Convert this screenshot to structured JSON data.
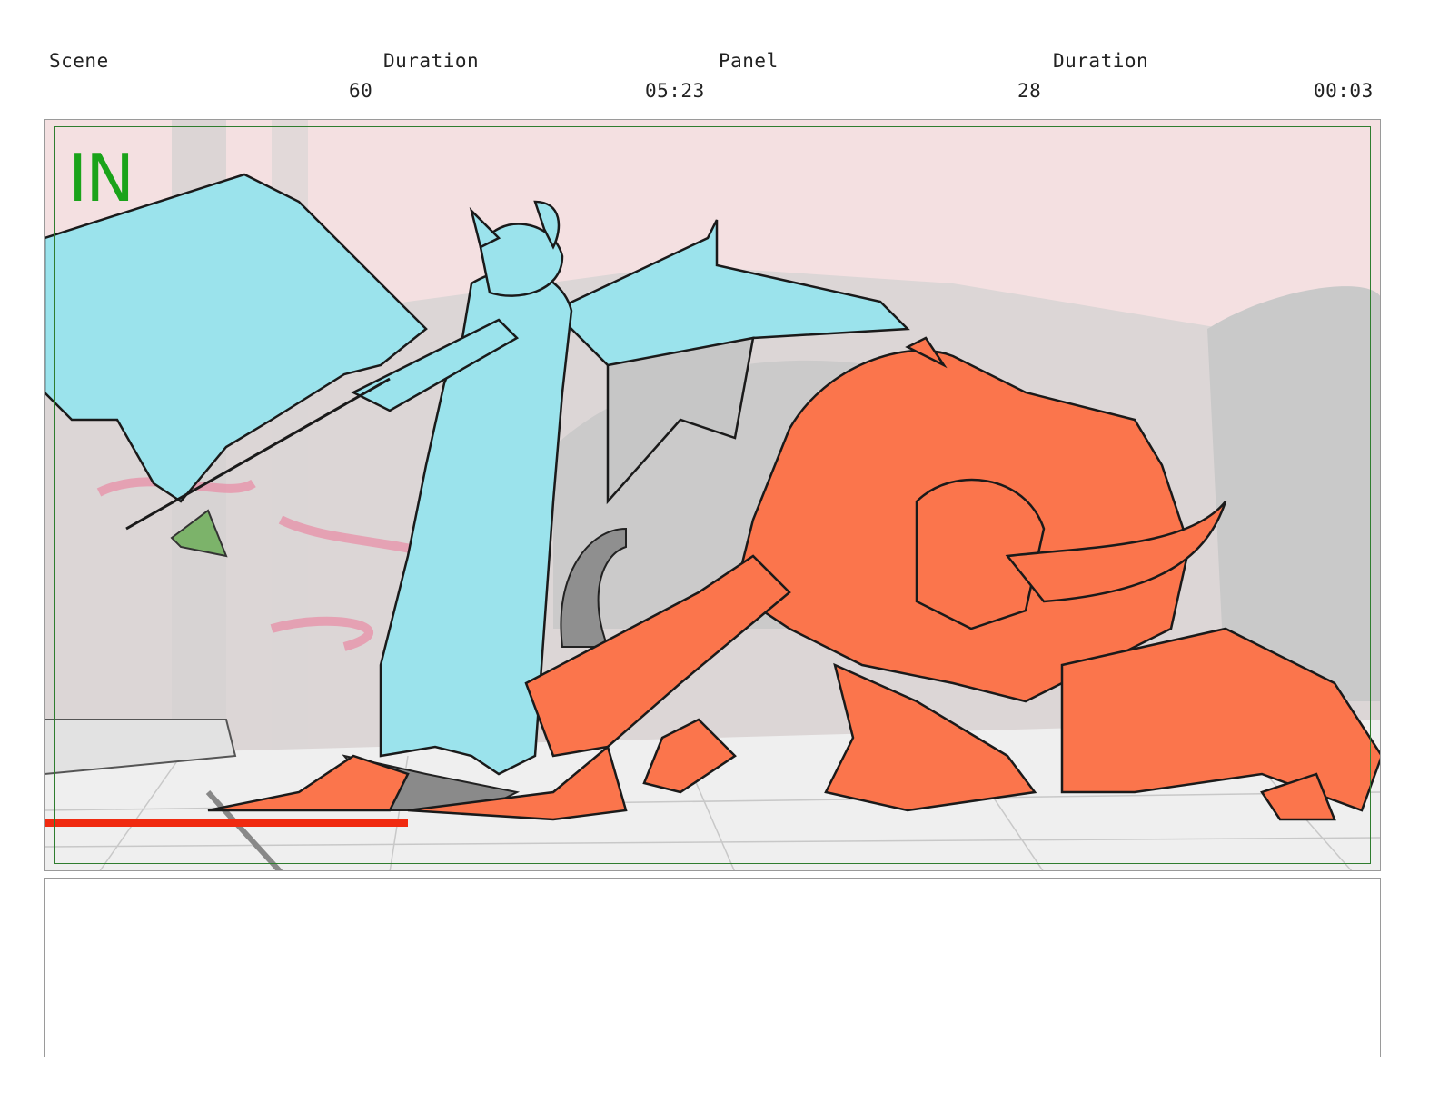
{
  "header": {
    "scene_label": "Scene",
    "scene_duration_label": "Duration",
    "panel_label": "Panel",
    "panel_duration_label": "Duration",
    "scene_value": "60",
    "scene_duration_value": "05:23",
    "panel_value": "28",
    "panel_duration_value": "00:03"
  },
  "panel": {
    "marker": "IN"
  },
  "colors": {
    "frame": "#9a9a9a",
    "safe_frame": "#2f7d2f",
    "marker": "#1aa31a",
    "blue_character": "#9be3ec",
    "red_character": "#fb754c",
    "background_pink": "#f4e0e1"
  },
  "notes": {
    "text": ""
  }
}
